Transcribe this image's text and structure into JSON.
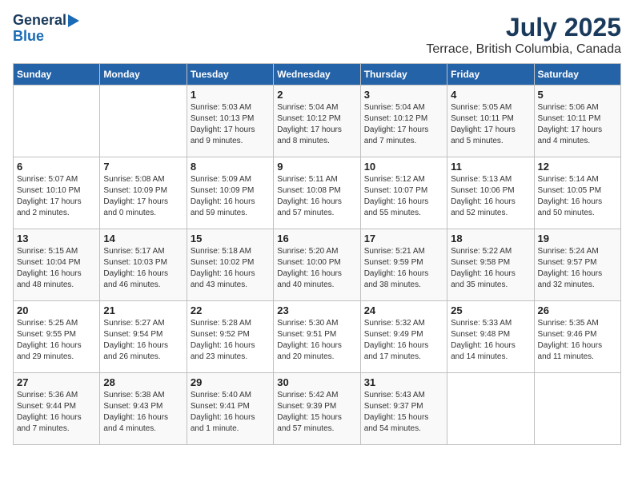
{
  "logo": {
    "line1": "General",
    "line2": "Blue"
  },
  "title": "July 2025",
  "subtitle": "Terrace, British Columbia, Canada",
  "days_of_week": [
    "Sunday",
    "Monday",
    "Tuesday",
    "Wednesday",
    "Thursday",
    "Friday",
    "Saturday"
  ],
  "weeks": [
    [
      {
        "day": "",
        "info": ""
      },
      {
        "day": "",
        "info": ""
      },
      {
        "day": "1",
        "info": "Sunrise: 5:03 AM\nSunset: 10:13 PM\nDaylight: 17 hours\nand 9 minutes."
      },
      {
        "day": "2",
        "info": "Sunrise: 5:04 AM\nSunset: 10:12 PM\nDaylight: 17 hours\nand 8 minutes."
      },
      {
        "day": "3",
        "info": "Sunrise: 5:04 AM\nSunset: 10:12 PM\nDaylight: 17 hours\nand 7 minutes."
      },
      {
        "day": "4",
        "info": "Sunrise: 5:05 AM\nSunset: 10:11 PM\nDaylight: 17 hours\nand 5 minutes."
      },
      {
        "day": "5",
        "info": "Sunrise: 5:06 AM\nSunset: 10:11 PM\nDaylight: 17 hours\nand 4 minutes."
      }
    ],
    [
      {
        "day": "6",
        "info": "Sunrise: 5:07 AM\nSunset: 10:10 PM\nDaylight: 17 hours\nand 2 minutes."
      },
      {
        "day": "7",
        "info": "Sunrise: 5:08 AM\nSunset: 10:09 PM\nDaylight: 17 hours\nand 0 minutes."
      },
      {
        "day": "8",
        "info": "Sunrise: 5:09 AM\nSunset: 10:09 PM\nDaylight: 16 hours\nand 59 minutes."
      },
      {
        "day": "9",
        "info": "Sunrise: 5:11 AM\nSunset: 10:08 PM\nDaylight: 16 hours\nand 57 minutes."
      },
      {
        "day": "10",
        "info": "Sunrise: 5:12 AM\nSunset: 10:07 PM\nDaylight: 16 hours\nand 55 minutes."
      },
      {
        "day": "11",
        "info": "Sunrise: 5:13 AM\nSunset: 10:06 PM\nDaylight: 16 hours\nand 52 minutes."
      },
      {
        "day": "12",
        "info": "Sunrise: 5:14 AM\nSunset: 10:05 PM\nDaylight: 16 hours\nand 50 minutes."
      }
    ],
    [
      {
        "day": "13",
        "info": "Sunrise: 5:15 AM\nSunset: 10:04 PM\nDaylight: 16 hours\nand 48 minutes."
      },
      {
        "day": "14",
        "info": "Sunrise: 5:17 AM\nSunset: 10:03 PM\nDaylight: 16 hours\nand 46 minutes."
      },
      {
        "day": "15",
        "info": "Sunrise: 5:18 AM\nSunset: 10:02 PM\nDaylight: 16 hours\nand 43 minutes."
      },
      {
        "day": "16",
        "info": "Sunrise: 5:20 AM\nSunset: 10:00 PM\nDaylight: 16 hours\nand 40 minutes."
      },
      {
        "day": "17",
        "info": "Sunrise: 5:21 AM\nSunset: 9:59 PM\nDaylight: 16 hours\nand 38 minutes."
      },
      {
        "day": "18",
        "info": "Sunrise: 5:22 AM\nSunset: 9:58 PM\nDaylight: 16 hours\nand 35 minutes."
      },
      {
        "day": "19",
        "info": "Sunrise: 5:24 AM\nSunset: 9:57 PM\nDaylight: 16 hours\nand 32 minutes."
      }
    ],
    [
      {
        "day": "20",
        "info": "Sunrise: 5:25 AM\nSunset: 9:55 PM\nDaylight: 16 hours\nand 29 minutes."
      },
      {
        "day": "21",
        "info": "Sunrise: 5:27 AM\nSunset: 9:54 PM\nDaylight: 16 hours\nand 26 minutes."
      },
      {
        "day": "22",
        "info": "Sunrise: 5:28 AM\nSunset: 9:52 PM\nDaylight: 16 hours\nand 23 minutes."
      },
      {
        "day": "23",
        "info": "Sunrise: 5:30 AM\nSunset: 9:51 PM\nDaylight: 16 hours\nand 20 minutes."
      },
      {
        "day": "24",
        "info": "Sunrise: 5:32 AM\nSunset: 9:49 PM\nDaylight: 16 hours\nand 17 minutes."
      },
      {
        "day": "25",
        "info": "Sunrise: 5:33 AM\nSunset: 9:48 PM\nDaylight: 16 hours\nand 14 minutes."
      },
      {
        "day": "26",
        "info": "Sunrise: 5:35 AM\nSunset: 9:46 PM\nDaylight: 16 hours\nand 11 minutes."
      }
    ],
    [
      {
        "day": "27",
        "info": "Sunrise: 5:36 AM\nSunset: 9:44 PM\nDaylight: 16 hours\nand 7 minutes."
      },
      {
        "day": "28",
        "info": "Sunrise: 5:38 AM\nSunset: 9:43 PM\nDaylight: 16 hours\nand 4 minutes."
      },
      {
        "day": "29",
        "info": "Sunrise: 5:40 AM\nSunset: 9:41 PM\nDaylight: 16 hours\nand 1 minute."
      },
      {
        "day": "30",
        "info": "Sunrise: 5:42 AM\nSunset: 9:39 PM\nDaylight: 15 hours\nand 57 minutes."
      },
      {
        "day": "31",
        "info": "Sunrise: 5:43 AM\nSunset: 9:37 PM\nDaylight: 15 hours\nand 54 minutes."
      },
      {
        "day": "",
        "info": ""
      },
      {
        "day": "",
        "info": ""
      }
    ]
  ]
}
